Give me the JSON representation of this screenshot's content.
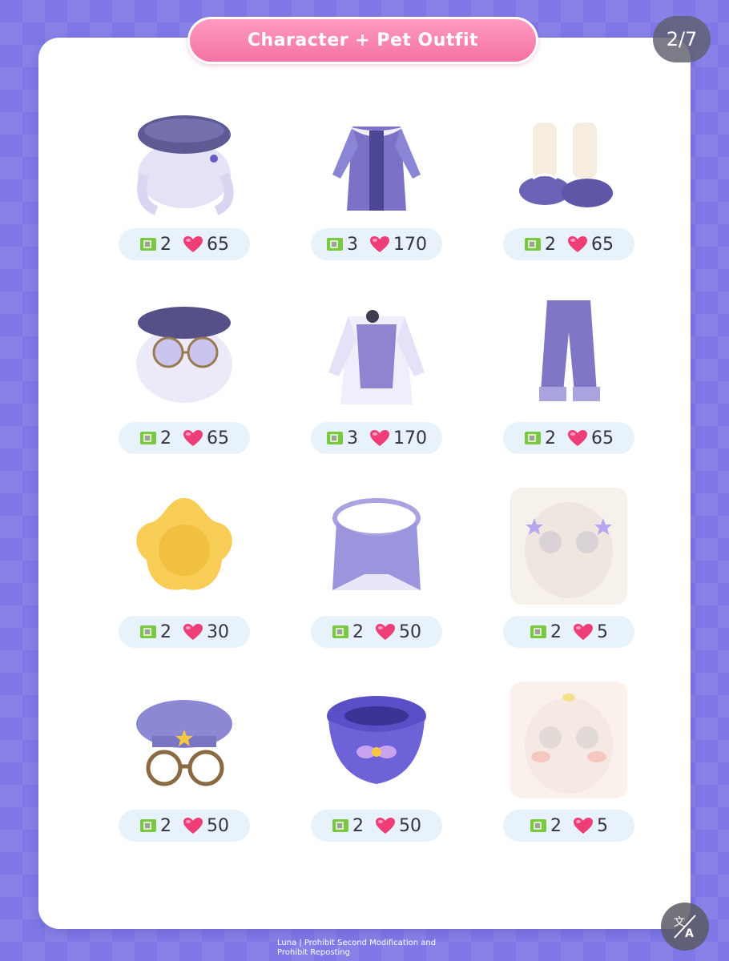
{
  "header": {
    "title": "Character + Pet Outfit",
    "page_indicator": "2/7"
  },
  "footer": {
    "line1": "Luna | Prohibit Second Modification and",
    "line2": "Prohibit Reposting"
  },
  "colors": {
    "accent_pink": "#f472a5",
    "background": "#7f78e6",
    "ticket_green": "#7ac943",
    "heart_pink": "#ef3d78",
    "price_pill": "#e8f2fb"
  },
  "items": [
    {
      "icon": "purple-beret-hair-icon",
      "tickets": "2",
      "hearts": "65"
    },
    {
      "icon": "purple-jacket-dress-icon",
      "tickets": "3",
      "hearts": "170"
    },
    {
      "icon": "leg-warmer-shoes-icon",
      "tickets": "2",
      "hearts": "65"
    },
    {
      "icon": "hat-glasses-hair-icon",
      "tickets": "2",
      "hearts": "65"
    },
    {
      "icon": "white-cape-outfit-icon",
      "tickets": "3",
      "hearts": "170"
    },
    {
      "icon": "purple-pants-icon",
      "tickets": "2",
      "hearts": "65"
    },
    {
      "icon": "yellow-star-pillow-icon",
      "tickets": "2",
      "hearts": "30"
    },
    {
      "icon": "collar-cape-icon",
      "tickets": "2",
      "hearts": "50"
    },
    {
      "icon": "star-eye-makeup-face-icon",
      "tickets": "2",
      "hearts": "5"
    },
    {
      "icon": "pet-beret-glasses-icon",
      "tickets": "2",
      "hearts": "50"
    },
    {
      "icon": "pet-star-collar-icon",
      "tickets": "2",
      "hearts": "50"
    },
    {
      "icon": "blush-makeup-face-icon",
      "tickets": "2",
      "hearts": "5"
    }
  ]
}
